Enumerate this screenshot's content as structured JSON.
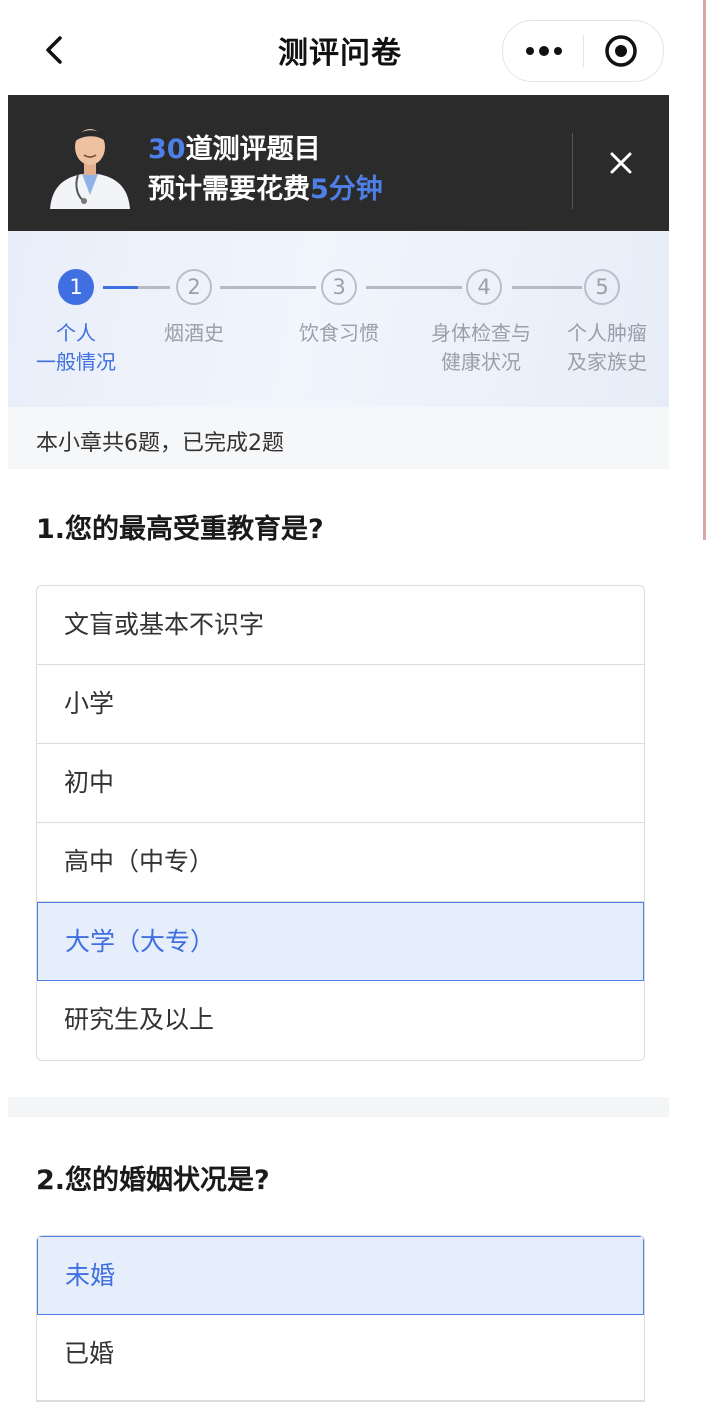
{
  "header": {
    "title": "测评问卷",
    "back_icon": "chevron-left-icon",
    "more_icon": "more-dots-icon",
    "scan_icon": "target-circle-icon"
  },
  "banner": {
    "count": "30",
    "line1_suffix": "道测评题目",
    "line2_prefix": "预计需要花费",
    "duration": "5分钟",
    "avatar_icon": "doctor-avatar-icon",
    "close_icon": "close-icon",
    "accent_color": "#4d7fe6"
  },
  "steps": [
    {
      "num": "1",
      "label_line1": "个人",
      "label_line2": "一般情况",
      "active": true
    },
    {
      "num": "2",
      "label_line1": "烟酒史",
      "label_line2": "",
      "active": false
    },
    {
      "num": "3",
      "label_line1": "饮食习惯",
      "label_line2": "",
      "active": false
    },
    {
      "num": "4",
      "label_line1": "身体检查与",
      "label_line2": "健康状况",
      "active": false
    },
    {
      "num": "5",
      "label_line1": "个人肿瘤",
      "label_line2": "及家族史",
      "active": false
    }
  ],
  "chapter_info": "本小章共6题，已完成2题",
  "questions": [
    {
      "title": "1.您的最高受重教育是?",
      "options": [
        "文盲或基本不识字",
        "小学",
        "初中",
        "高中（中专）",
        "大学（大专）",
        "研究生及以上"
      ],
      "selected": "大学（大专）"
    },
    {
      "title": "2.您的婚姻状况是?",
      "options": [
        "未婚",
        "已婚"
      ],
      "selected": "未婚"
    }
  ],
  "colors": {
    "primary": "#3f6fe0",
    "selected_bg": "#e6eefb",
    "banner_bg": "#2b2b2b"
  }
}
